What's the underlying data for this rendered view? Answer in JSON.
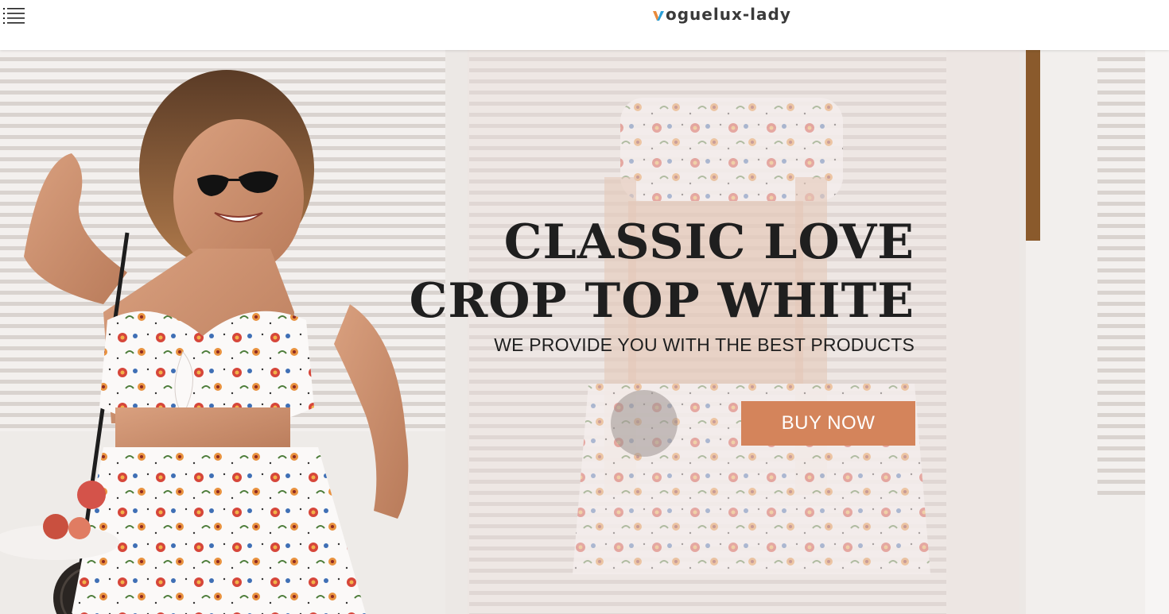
{
  "header": {
    "menu_icon": "hamburger-menu-icon",
    "logo_text": "oguelux-lady",
    "logo_mark_letter": "v",
    "logo_mark_colors": [
      "#e98a3a",
      "#2a9fd8"
    ]
  },
  "hero": {
    "headline_line1": "CLASSIC LOVE",
    "headline_line2": "CROP TOP WHITE",
    "subheadline": "WE PROVIDE YOU WITH THE BEST PRODUCTS",
    "cta_label": "BUY NOW",
    "cta_color": "#d4845b",
    "image_subject": "model-floral-crop-top-photo"
  }
}
